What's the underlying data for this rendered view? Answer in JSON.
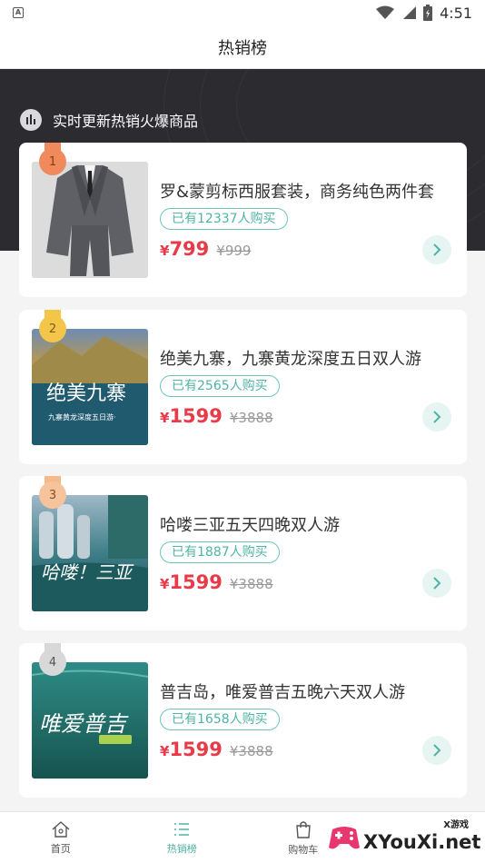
{
  "status_bar": {
    "time": "4:51",
    "app_glyph": "A",
    "icons": [
      "wifi-icon",
      "signal-icon",
      "battery-icon"
    ]
  },
  "header": {
    "title": "热销榜"
  },
  "banner": {
    "text": "实时更新热销火爆商品",
    "icon": "bar-chart-icon"
  },
  "products": [
    {
      "rank": "1",
      "name": "罗&蒙剪标西服套装，商务纯色两件套",
      "sold": "已有12337人购买",
      "currency": "¥",
      "price": "799",
      "original_price": "¥999",
      "medal_color": "#f08a5d"
    },
    {
      "rank": "2",
      "name": "绝美九寨，九寨黄龙深度五日双人游",
      "sold": "已有2565人购买",
      "currency": "¥",
      "price": "1599",
      "original_price": "¥3888",
      "medal_color": "#f3c64a",
      "image_caption": "绝美九寨",
      "image_subcaption": "九寨黄龙深度五日游·"
    },
    {
      "rank": "3",
      "name": "哈喽三亚五天四晚双人游",
      "sold": "已有1887人购买",
      "currency": "¥",
      "price": "1599",
      "original_price": "¥3888",
      "medal_color": "#f6b98a",
      "image_caption": "哈喽！三亚"
    },
    {
      "rank": "4",
      "name": "普吉岛，唯爱普吉五晚六天双人游",
      "sold": "已有1658人购买",
      "currency": "¥",
      "price": "1599",
      "original_price": "¥3888",
      "medal_color": "#d8d8d8",
      "image_caption": "唯爱普吉"
    }
  ],
  "bottom_nav": [
    {
      "label": "首页",
      "icon": "home-icon",
      "active": false
    },
    {
      "label": "热销榜",
      "icon": "list-icon",
      "active": true
    },
    {
      "label": "购物车",
      "icon": "shopping-bag-icon",
      "active": false
    }
  ],
  "watermark": {
    "brand": "XYouXi.net",
    "small": "X游戏"
  },
  "colors": {
    "accent": "#4fb3a6",
    "price": "#e83a48",
    "hero_bg": "#2b2b30"
  }
}
